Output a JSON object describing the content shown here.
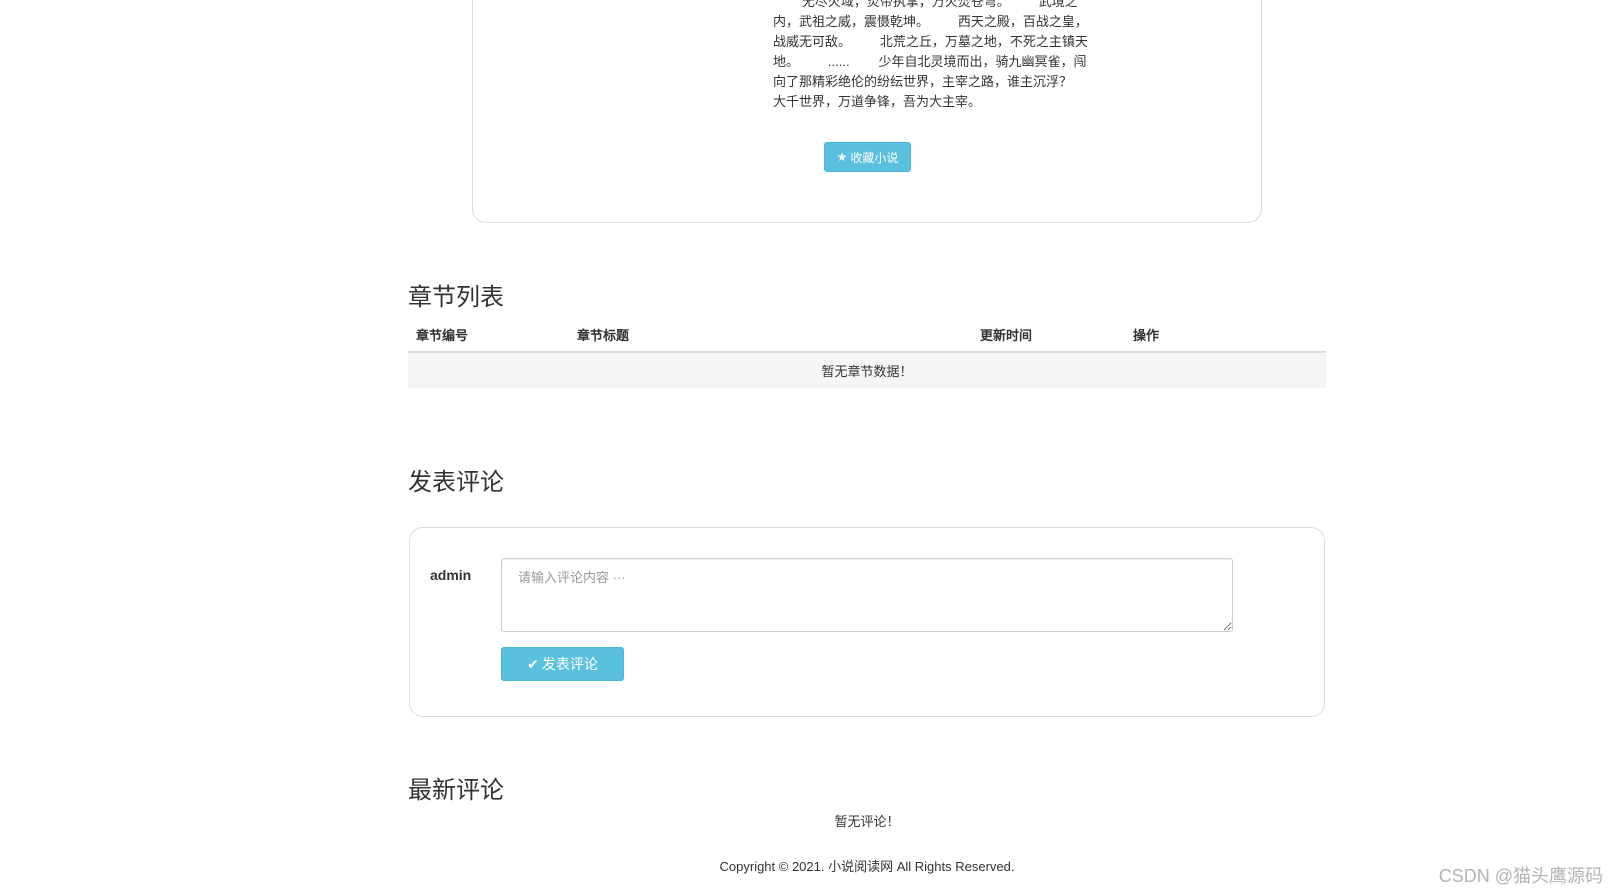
{
  "novel": {
    "intro": "        无尽火域，炎帝执掌，万火焚苍穹。        武境之内，武祖之威，震慑乾坤。        西天之殿，百战之皇，战威无可敌。        北荒之丘，万墓之地，不死之主镇天地。        ......        少年自北灵境而出，骑九幽冥雀，闯向了那精彩绝伦的纷纭世界，主宰之路，谁主沉浮？        大千世界，万道争锋，吾为大主宰。",
    "collect_label": "收藏小说",
    "collect_icon": "star-icon"
  },
  "chapters": {
    "title": "章节列表",
    "columns": [
      "章节编号",
      "章节标题",
      "更新时间",
      "操作"
    ],
    "empty_text": "暂无章节数据！"
  },
  "comment_form": {
    "title": "发表评论",
    "username": "admin",
    "placeholder": "请输入评论内容 ···",
    "value": "",
    "submit_label": "发表评论",
    "submit_icon": "checkmark-icon"
  },
  "latest_comments": {
    "title": "最新评论",
    "empty_text": "暂无评论！"
  },
  "footer": {
    "copyright": "Copyright © 2021. 小说阅读网 All Rights Reserved."
  },
  "watermark": "CSDN @猫头鹰源码",
  "colors": {
    "button_info": "#5bc0de",
    "button_info_border": "#46b8da",
    "card_border": "#dcdcdc",
    "empty_row_bg": "#f5f5f5"
  }
}
